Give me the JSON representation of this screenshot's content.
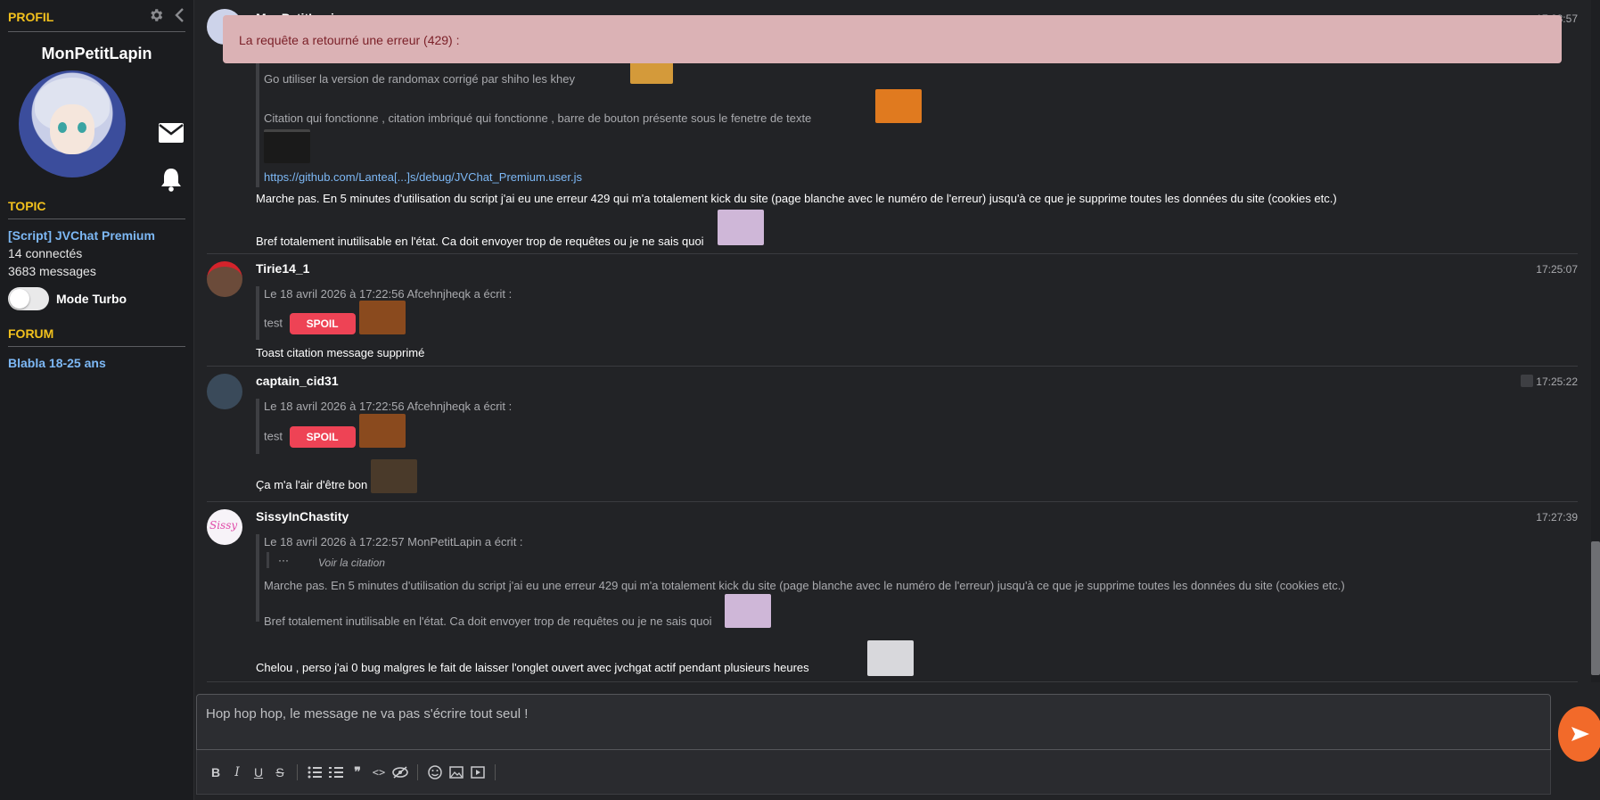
{
  "sidebar": {
    "profile_heading": "PROFIL",
    "username": "MonPetitLapin",
    "topic_heading": "TOPIC",
    "topic_title": "[Script] JVChat Premium",
    "connected": "14 connectés",
    "messages": "3683 messages",
    "turbo_label": "Mode Turbo",
    "forum_heading": "FORUM",
    "forum_name": "Blabla 18-25 ans"
  },
  "toast": {
    "text": "La requête a retourné une erreur (429) :"
  },
  "messages": [
    {
      "author": "MonPetitLapin",
      "time": "17:23:57",
      "quote_lines": [
        "Go utiliser la version de randomax corrigé par shiho les khey",
        "Citation qui fonctionne , citation imbriqué qui fonctionne , barre de bouton présente sous le fenetre de texte"
      ],
      "quote_link": "https://github.com/Lantea[...]s/debug/JVChat_Premium.user.js",
      "body_lines": [
        "Marche pas. En 5 minutes d'utilisation du script j'ai eu une erreur 429 qui m'a totalement kick du site (page blanche avec le numéro de l'erreur) jusqu'à ce que je supprime toutes les données du site (cookies etc.)",
        "Bref totalement inutilisable en l'état. Ca doit envoyer trop de requêtes ou je ne sais quoi"
      ]
    },
    {
      "author": "Tirie14_1",
      "time": "17:25:07",
      "quote_header": "Le 18 avril 2026 à 17:22:56 Afcehnjheqk a écrit :",
      "quote_text": "test",
      "spoil_label": "SPOIL",
      "body": "Toast citation message supprimé"
    },
    {
      "author": "captain_cid31",
      "time": "17:25:22",
      "quote_header": "Le 18 avril 2026 à 17:22:56 Afcehnjheqk a écrit :",
      "quote_text": "test",
      "spoil_label": "SPOIL",
      "body": "Ça m'a l'air d'être bon"
    },
    {
      "author": "SissyInChastity",
      "time": "17:27:39",
      "quote_header": "Le 18 avril 2026 à 17:22:57 MonPetitLapin a écrit :",
      "voir_label": "Voir la citation",
      "quote_lines": [
        "Marche pas. En 5 minutes d'utilisation du script j'ai eu une erreur 429 qui m'a totalement kick du site (page blanche avec le numéro de l'erreur) jusqu'à ce que je supprime toutes les données du site (cookies etc.)",
        "Bref totalement inutilisable en l'état. Ca doit envoyer trop de requêtes ou je ne sais quoi"
      ],
      "body": "Chelou , perso j'ai 0 bug malgres le fait de laisser l'onglet ouvert avec jvchgat actif pendant plusieurs heures"
    }
  ],
  "composer": {
    "placeholder": "Hop hop hop, le message ne va pas s'écrire tout seul !"
  },
  "colors": {
    "accent": "#f2c11d",
    "link": "#7db8f5",
    "spoil": "#ee4355",
    "send": "#f26a2a",
    "toast_bg": "#dbb2b5"
  }
}
